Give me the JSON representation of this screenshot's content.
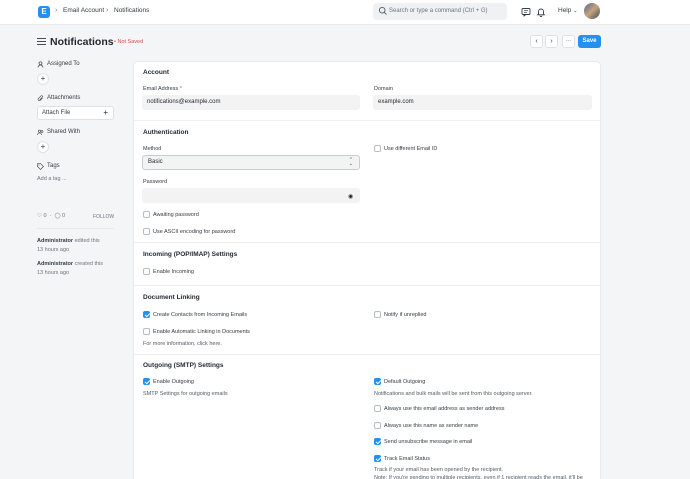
{
  "topbar": {
    "logo": "E",
    "breadcrumbs": [
      "Email Account",
      "Notifications"
    ],
    "search_placeholder": "Search or type a command (Ctrl + G)",
    "help_label": "Help"
  },
  "page": {
    "title": "Notifications",
    "status": "Not Saved",
    "prev_label": "‹",
    "next_label": "›",
    "more_label": "···",
    "save_label": "Save"
  },
  "sidebar": {
    "assigned_to": "Assigned To",
    "attachments": "Attachments",
    "attach_file": "Attach File",
    "shared_with": "Shared With",
    "tags": "Tags",
    "add_tag": "Add a tag ...",
    "likes": "0",
    "comments": "0",
    "follow": "FOLLOW",
    "activity": [
      {
        "user": "Administrator",
        "action": "edited this",
        "time": "13 hours ago"
      },
      {
        "user": "Administrator",
        "action": "created this",
        "time": "13 hours ago"
      }
    ]
  },
  "form": {
    "account": {
      "title": "Account",
      "email_label": "Email Address",
      "email_value": "notifications@example.com",
      "domain_label": "Domain",
      "domain_value": "example.com"
    },
    "authentication": {
      "title": "Authentication",
      "method_label": "Method",
      "method_value": "Basic",
      "password_label": "Password",
      "use_different_email": "Use different Email ID",
      "awaiting_password": "Awaiting password",
      "ascii_encoding": "Use ASCII encoding for password"
    },
    "incoming": {
      "title": "Incoming (POP/IMAP) Settings",
      "enable_incoming": "Enable Incoming"
    },
    "document_linking": {
      "title": "Document Linking",
      "create_contacts": "Create Contacts from Incoming Emails",
      "notify_unreplied": "Notify if unreplied",
      "auto_linking": "Enable Automatic Linking in Documents",
      "more_info": "For more information, click here."
    },
    "outgoing": {
      "title": "Outgoing (SMTP) Settings",
      "enable_outgoing": "Enable Outgoing",
      "smtp_desc": "SMTP Settings for outgoing emails",
      "default_outgoing": "Default Outgoing",
      "default_desc": "Notifications and bulk mails will be sent from this outgoing server.",
      "always_email_sender": "Always use this email address as sender address",
      "always_name_sender": "Always use this name as sender name",
      "send_unsubscribe": "Send unsubscribe message in email",
      "track_status": "Track Email Status",
      "track_desc": "Track if your email has been opened by the recipient.",
      "track_note": "Note: If you're sending to multiple recipients, even if 1 recipient reads the email, it'll be"
    }
  },
  "colors": {
    "accent": "#2490ef",
    "danger": "#e24c4c"
  }
}
